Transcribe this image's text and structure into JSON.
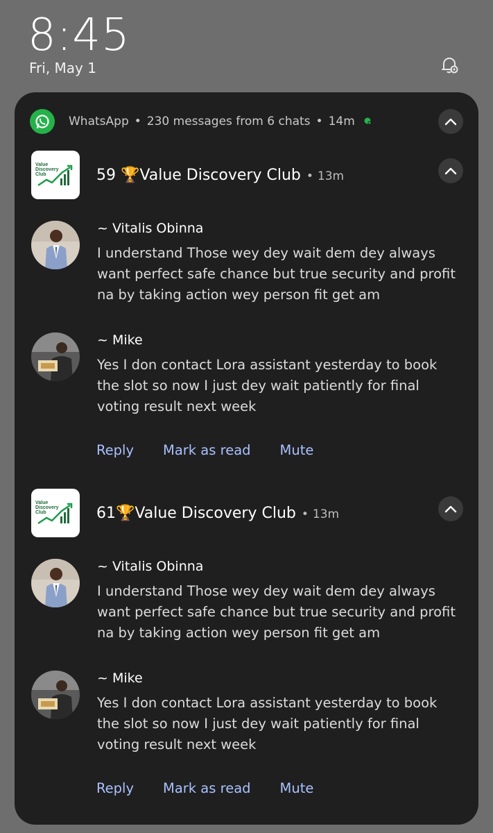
{
  "lockscreen": {
    "time": "8:45",
    "date": "Fri, May 1"
  },
  "notification": {
    "app_name": "WhatsApp",
    "separator": "•",
    "summary": "230 messages from 6 chats",
    "age": "14m",
    "groups": [
      {
        "title": "59 🏆Value Discovery Club",
        "time": "13m",
        "icon_text": "Value Discovery Club",
        "messages": [
          {
            "sender": "~ Vitalis Obinna",
            "text": "I understand Those wey dey wait dem dey always want perfect safe chance but true security and profit na by taking action wey person fit get am"
          },
          {
            "sender": "~ Mike",
            "text": "Yes I don contact Lora assistant yesterday to book the slot so now I just dey wait patiently for final voting result next week"
          }
        ],
        "actions": [
          "Reply",
          "Mark as read",
          "Mute"
        ]
      },
      {
        "title": "61🏆Value Discovery Club",
        "time": "13m",
        "icon_text": "Value Discovery Club",
        "messages": [
          {
            "sender": "~ Vitalis Obinna",
            "text": "I understand Those wey dey wait dem dey always want perfect safe chance but true security and profit na by taking action wey person fit get am"
          },
          {
            "sender": "~ Mike",
            "text": "Yes I don contact Lora assistant yesterday to book the slot so now I just dey wait patiently for final voting result next week"
          }
        ],
        "actions": [
          "Reply",
          "Mark as read",
          "Mute"
        ]
      }
    ]
  },
  "colors": {
    "whatsapp_green": "#25b24a",
    "panel_bg": "#1f1f1f",
    "action_blue": "#a9c1ff"
  }
}
